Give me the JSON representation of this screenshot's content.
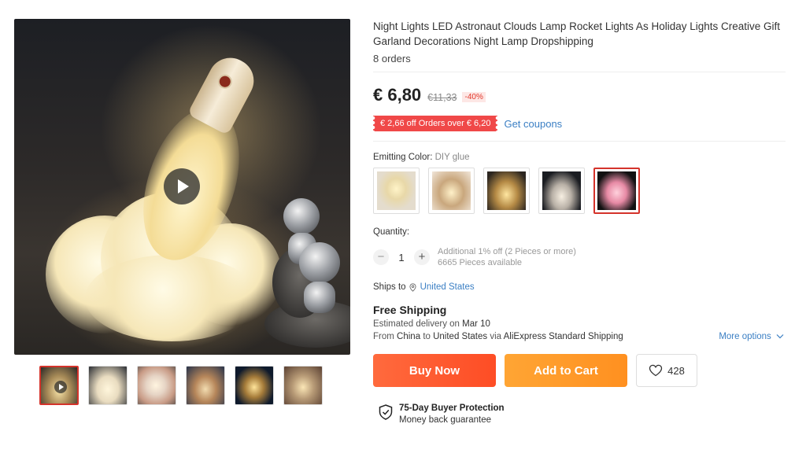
{
  "product": {
    "title": "Night Lights LED Astronaut Clouds Lamp Rocket Lights As Holiday Lights Creative Gift Garland Decorations Night Lamp Dropshipping",
    "orders": "8 orders"
  },
  "pricing": {
    "price": "€ 6,80",
    "original_price": "€11,33",
    "discount": "-40%",
    "coupon_text": "€ 2,66 off Orders over € 6,20",
    "get_coupons_label": "Get coupons"
  },
  "variant": {
    "label": "Emitting Color:",
    "selected": "DIY glue",
    "options_count": 5
  },
  "quantity": {
    "label": "Quantity:",
    "decrement": "−",
    "increment": "+",
    "value": "1",
    "note_line1": "Additional 1% off (2 Pieces or more)",
    "note_line2": "6665 Pieces available"
  },
  "shipping": {
    "ships_to_label": "Ships to",
    "country": "United States",
    "free_label": "Free Shipping",
    "estimated_label": "Estimated delivery on",
    "estimated_date": "Mar 10",
    "from_label": "From",
    "from_country": "China",
    "to_label": "to",
    "to_country": "United States",
    "via_label": "via",
    "carrier": "AliExpress Standard Shipping",
    "more_options": "More options"
  },
  "actions": {
    "buy_now": "Buy Now",
    "add_to_cart": "Add to Cart",
    "wishlist_count": "428"
  },
  "protection": {
    "title": "75-Day Buyer Protection",
    "subtitle": "Money back guarantee"
  },
  "colors": {
    "accent_red": "#d4332b",
    "buy_orange": "#fe4d25",
    "cart_orange": "#ff9020",
    "link_blue": "#3b7fc4",
    "coupon_red": "#f04848"
  },
  "icons": {
    "play": "play-icon",
    "location": "location-pin-icon",
    "chevron": "chevron-down-icon",
    "heart": "heart-icon",
    "shield": "shield-check-icon"
  }
}
